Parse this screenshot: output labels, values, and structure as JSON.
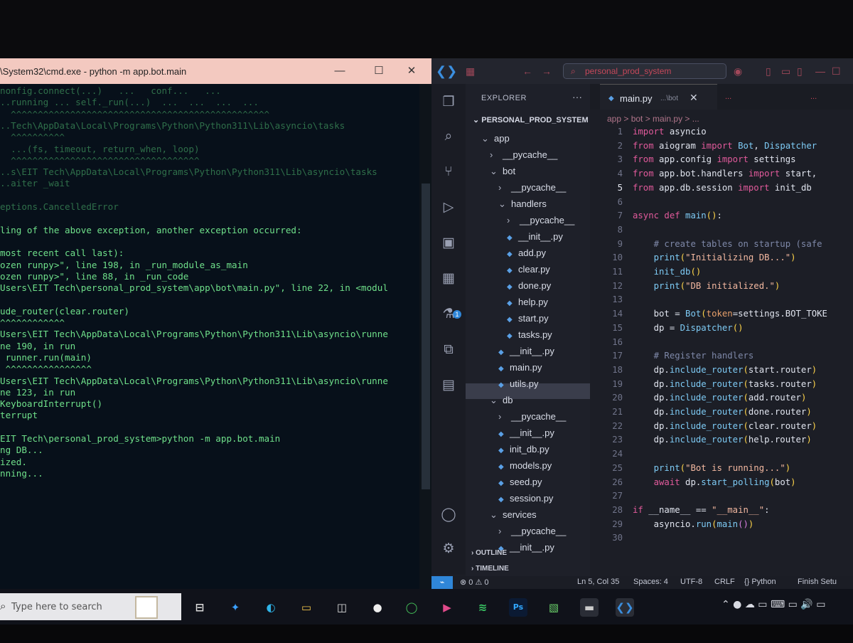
{
  "cmd": {
    "title": "\\System32\\cmd.exe - python  -m app.bot.main",
    "controls": {
      "minimize": "—",
      "maximize": "☐",
      "close": "✕"
    },
    "lines": [
      {
        "text": "nonfig.connect(...)   ...   conf...   ...",
        "dim": true
      },
      {
        "text": "..running ... self._run(...)  ...  ...  ...  ...",
        "dim": true
      },
      {
        "text": "  ^^^^^^^^^^^^^^^^^^^^^^^^^^^^^^^^^^^^^^^^^^^^^^^^",
        "dim": true
      },
      {
        "text": "..Tech\\AppData\\Local\\Programs\\Python\\Python311\\Lib\\asyncio\\tasks",
        "dim": true
      },
      {
        "text": "  ^^^^^^^^^^",
        "dim": true
      },
      {
        "text": "  ...(fs, timeout, return_when, loop)",
        "dim": true
      },
      {
        "text": "  ^^^^^^^^^^^^^^^^^^^^^^^^^^^^^^^^^^^",
        "dim": true
      },
      {
        "text": "..s\\EIT Tech\\AppData\\Local\\Programs\\Python\\Python311\\Lib\\asyncio\\tasks",
        "dim": true
      },
      {
        "text": "..aiter _wait",
        "dim": true
      },
      {
        "text": "",
        "dim": true
      },
      {
        "text": "eptions.CancelledError",
        "dim": true
      },
      {
        "text": "",
        "dim": false
      },
      {
        "text": "ling of the above exception, another exception occurred:",
        "dim": false
      },
      {
        "text": "",
        "dim": false
      },
      {
        "text": "most recent call last):",
        "dim": false
      },
      {
        "text": "ozen runpy>\", line 198, in _run_module_as_main",
        "dim": false
      },
      {
        "text": "ozen runpy>\", line 88, in _run_code",
        "dim": false
      },
      {
        "text": "Users\\EIT Tech\\personal_prod_system\\app\\bot\\main.py\", line 22, in <modul",
        "dim": false
      },
      {
        "text": "",
        "dim": false
      },
      {
        "text": "ude_router(clear.router)",
        "dim": false
      },
      {
        "text": "^^^^^^^^^^^^",
        "dim": false
      },
      {
        "text": "Users\\EIT Tech\\AppData\\Local\\Programs\\Python\\Python311\\Lib\\asyncio\\runne",
        "dim": false
      },
      {
        "text": "ne 190, in run",
        "dim": false
      },
      {
        "text": " runner.run(main)",
        "dim": false
      },
      {
        "text": " ^^^^^^^^^^^^^^^^",
        "dim": false
      },
      {
        "text": "Users\\EIT Tech\\AppData\\Local\\Programs\\Python\\Python311\\Lib\\asyncio\\runne",
        "dim": false
      },
      {
        "text": "ne 123, in run",
        "dim": false
      },
      {
        "text": "KeyboardInterrupt()",
        "dim": false
      },
      {
        "text": "terrupt",
        "dim": false
      },
      {
        "text": "",
        "dim": false
      },
      {
        "text": "EIT Tech\\personal_prod_system>python -m app.bot.main",
        "dim": false
      },
      {
        "text": "ng DB...",
        "dim": false
      },
      {
        "text": "ized.",
        "dim": false
      },
      {
        "text": "nning...",
        "dim": false
      }
    ]
  },
  "vscode": {
    "search_text": "personal_prod_system",
    "explorer_title": "EXPLORER",
    "more": "···",
    "project": "PERSONAL_PROD_SYSTEM",
    "tree": [
      {
        "label": "app",
        "indent": 0,
        "kind": "folder-open"
      },
      {
        "label": "__pycache__",
        "indent": 1,
        "kind": "folder-closed"
      },
      {
        "label": "bot",
        "indent": 1,
        "kind": "folder-open"
      },
      {
        "label": "__pycache__",
        "indent": 2,
        "kind": "folder-closed"
      },
      {
        "label": "handlers",
        "indent": 2,
        "kind": "folder-open"
      },
      {
        "label": "__pycache__",
        "indent": 3,
        "kind": "folder-closed"
      },
      {
        "label": "__init__.py",
        "indent": 3,
        "kind": "file"
      },
      {
        "label": "add.py",
        "indent": 3,
        "kind": "file"
      },
      {
        "label": "clear.py",
        "indent": 3,
        "kind": "file"
      },
      {
        "label": "done.py",
        "indent": 3,
        "kind": "file"
      },
      {
        "label": "help.py",
        "indent": 3,
        "kind": "file"
      },
      {
        "label": "start.py",
        "indent": 3,
        "kind": "file"
      },
      {
        "label": "tasks.py",
        "indent": 3,
        "kind": "file"
      },
      {
        "label": "__init__.py",
        "indent": 2,
        "kind": "file"
      },
      {
        "label": "main.py",
        "indent": 2,
        "kind": "file",
        "selected": true
      },
      {
        "label": "utils.py",
        "indent": 2,
        "kind": "file"
      },
      {
        "label": "db",
        "indent": 1,
        "kind": "folder-open"
      },
      {
        "label": "__pycache__",
        "indent": 2,
        "kind": "folder-closed"
      },
      {
        "label": "__init__.py",
        "indent": 2,
        "kind": "file"
      },
      {
        "label": "init_db.py",
        "indent": 2,
        "kind": "file"
      },
      {
        "label": "models.py",
        "indent": 2,
        "kind": "file"
      },
      {
        "label": "seed.py",
        "indent": 2,
        "kind": "file"
      },
      {
        "label": "session.py",
        "indent": 2,
        "kind": "file"
      },
      {
        "label": "services",
        "indent": 1,
        "kind": "folder-open"
      },
      {
        "label": "__pycache__",
        "indent": 2,
        "kind": "folder-closed"
      },
      {
        "label": "__init__.py",
        "indent": 2,
        "kind": "file"
      }
    ],
    "sections": {
      "outline": "OUTLINE",
      "timeline": "TIMELINE"
    },
    "tab": {
      "label": "main.py",
      "desc": "...\\bot",
      "close": "✕",
      "tab2": "...",
      "tab3": "..."
    },
    "breadcrumb": "app > bot > main.py > ...",
    "active_line": 5,
    "code": [
      [
        [
          "kw",
          "import "
        ],
        [
          "plain",
          "asyncio"
        ]
      ],
      [
        [
          "kw",
          "from "
        ],
        [
          "plain",
          "aiogram "
        ],
        [
          "kw",
          "import "
        ],
        [
          "cls",
          "Bot"
        ],
        [
          "plain",
          ", "
        ],
        [
          "cls",
          "Dispatcher"
        ]
      ],
      [
        [
          "kw",
          "from "
        ],
        [
          "plain",
          "app.config "
        ],
        [
          "kw",
          "import "
        ],
        [
          "plain",
          "settings"
        ]
      ],
      [
        [
          "kw",
          "from "
        ],
        [
          "plain",
          "app.bot.handlers "
        ],
        [
          "kw",
          "import "
        ],
        [
          "plain",
          "start,"
        ]
      ],
      [
        [
          "kw",
          "from "
        ],
        [
          "plain",
          "app.db.session "
        ],
        [
          "kw",
          "import "
        ],
        [
          "plain",
          "init_db"
        ]
      ],
      [],
      [
        [
          "kw",
          "async def "
        ],
        [
          "fn",
          "main"
        ],
        [
          "brk1",
          "()"
        ],
        [
          "plain",
          ":"
        ]
      ],
      [],
      [
        [
          "plain",
          "    "
        ],
        [
          "cmt",
          "# create tables on startup (safe"
        ]
      ],
      [
        [
          "plain",
          "    "
        ],
        [
          "fn",
          "print"
        ],
        [
          "brk1",
          "("
        ],
        [
          "str",
          "\"Initializing DB...\""
        ],
        [
          "brk1",
          ")"
        ]
      ],
      [
        [
          "plain",
          "    "
        ],
        [
          "fn",
          "init_db"
        ],
        [
          "brk1",
          "()"
        ]
      ],
      [
        [
          "plain",
          "    "
        ],
        [
          "fn",
          "print"
        ],
        [
          "brk1",
          "("
        ],
        [
          "str",
          "\"DB initialized.\""
        ],
        [
          "brk1",
          ")"
        ]
      ],
      [],
      [
        [
          "plain",
          "    bot = "
        ],
        [
          "cls",
          "Bot"
        ],
        [
          "brk1",
          "("
        ],
        [
          "param",
          "token"
        ],
        [
          "plain",
          "=settings.BOT_TOKE"
        ]
      ],
      [
        [
          "plain",
          "    dp = "
        ],
        [
          "cls",
          "Dispatcher"
        ],
        [
          "brk1",
          "()"
        ]
      ],
      [],
      [
        [
          "plain",
          "    "
        ],
        [
          "cmt",
          "# Register handlers"
        ]
      ],
      [
        [
          "plain",
          "    dp."
        ],
        [
          "fn",
          "include_router"
        ],
        [
          "brk1",
          "("
        ],
        [
          "plain",
          "start.router"
        ],
        [
          "brk1",
          ")"
        ]
      ],
      [
        [
          "plain",
          "    dp."
        ],
        [
          "fn",
          "include_router"
        ],
        [
          "brk1",
          "("
        ],
        [
          "plain",
          "tasks.router"
        ],
        [
          "brk1",
          ")"
        ]
      ],
      [
        [
          "plain",
          "    dp."
        ],
        [
          "fn",
          "include_router"
        ],
        [
          "brk1",
          "("
        ],
        [
          "plain",
          "add.router"
        ],
        [
          "brk1",
          ")"
        ]
      ],
      [
        [
          "plain",
          "    dp."
        ],
        [
          "fn",
          "include_router"
        ],
        [
          "brk1",
          "("
        ],
        [
          "plain",
          "done.router"
        ],
        [
          "brk1",
          ")"
        ]
      ],
      [
        [
          "plain",
          "    dp."
        ],
        [
          "fn",
          "include_router"
        ],
        [
          "brk1",
          "("
        ],
        [
          "plain",
          "clear.router"
        ],
        [
          "brk1",
          ")"
        ]
      ],
      [
        [
          "plain",
          "    dp."
        ],
        [
          "fn",
          "include_router"
        ],
        [
          "brk1",
          "("
        ],
        [
          "plain",
          "help.router"
        ],
        [
          "brk1",
          ")"
        ]
      ],
      [],
      [
        [
          "plain",
          "    "
        ],
        [
          "fn",
          "print"
        ],
        [
          "brk1",
          "("
        ],
        [
          "str",
          "\"Bot is running...\""
        ],
        [
          "brk1",
          ")"
        ]
      ],
      [
        [
          "plain",
          "    "
        ],
        [
          "kw",
          "await "
        ],
        [
          "plain",
          "dp."
        ],
        [
          "fn",
          "start_polling"
        ],
        [
          "brk1",
          "("
        ],
        [
          "plain",
          "bot"
        ],
        [
          "brk1",
          ")"
        ]
      ],
      [],
      [
        [
          "kw",
          "if "
        ],
        [
          "plain",
          "__name__ == "
        ],
        [
          "str",
          "\"__main__\""
        ],
        [
          "plain",
          ":"
        ]
      ],
      [
        [
          "plain",
          "    asyncio."
        ],
        [
          "fn",
          "run"
        ],
        [
          "brk1",
          "("
        ],
        [
          "fn",
          "main"
        ],
        [
          "brk2",
          "()"
        ],
        [
          "brk1",
          ")"
        ]
      ],
      []
    ],
    "status": {
      "errors": "⊗ 0 ⚠ 0",
      "position": "Ln 5, Col 35",
      "spaces": "Spaces: 4",
      "encoding": "UTF-8",
      "eol": "CRLF",
      "language": "{} Python",
      "setup": "Finish Setu"
    }
  },
  "taskbar": {
    "search_placeholder": "Type here to search",
    "tray": "⌃ ● ☁ ▭ ⌨ ▭ 🔊 ▭"
  },
  "colors": {
    "terminal_text": "#6fe08a",
    "keyword": "#e15a9b",
    "function": "#7ecbf5",
    "string": "#f3b8a0",
    "accent": "#2f86d8"
  }
}
